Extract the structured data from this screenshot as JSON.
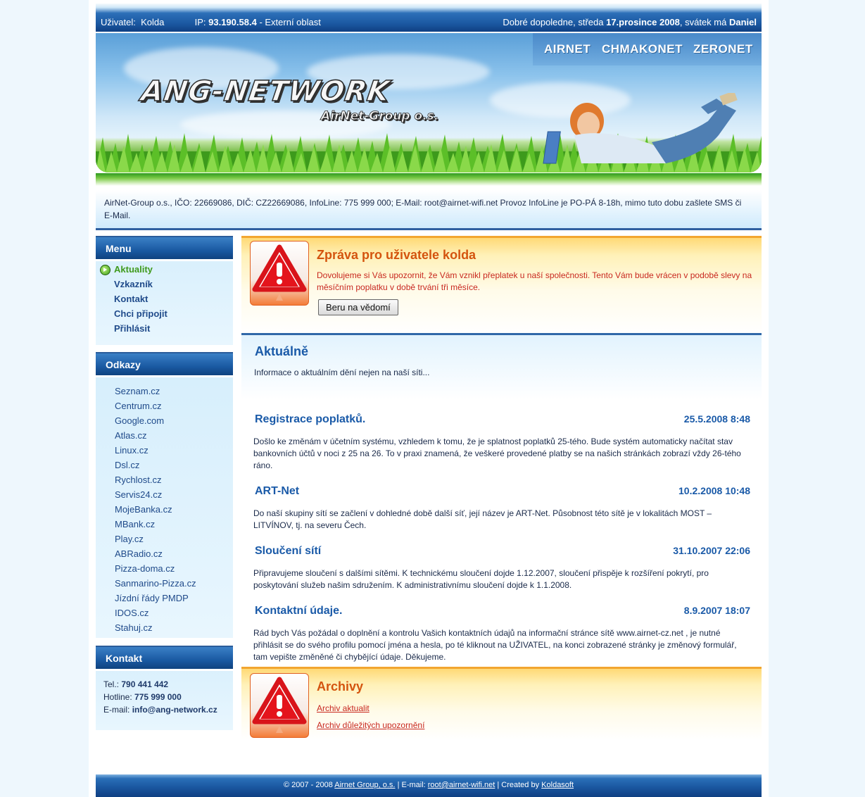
{
  "topbar": {
    "user_label": "Uživatel:",
    "user_name": "Kolda",
    "ip_label": "IP:",
    "ip_value": "93.190.58.4",
    "ip_zone": "- Externí oblast",
    "greeting": "Dobré dopoledne, středa",
    "date": "17.prosince 2008",
    "nameday_label": ", svátek má",
    "nameday_name": "Daniel"
  },
  "header": {
    "logo": "ANG-NETWORK",
    "sublogo": "AirNet-Group o.s.",
    "nav": [
      "AIRNET",
      "CHMAKONET",
      "ZERONET"
    ]
  },
  "info_strip": "AirNet-Group o.s., IČO: 22669086, DIČ: CZ22669086, InfoLine: 775 999 000; E-Mail: root@airnet-wifi.net Provoz InfoLine je PO-PÁ 8-18h, mimo tuto dobu zašlete SMS či E-Mail.",
  "sidebar": {
    "menu_title": "Menu",
    "menu_items": [
      "Aktuality",
      "Vzkazník",
      "Kontakt",
      "Chci připojit",
      "Přihlásit"
    ],
    "links_title": "Odkazy",
    "links": [
      "Seznam.cz",
      "Centrum.cz",
      "Google.com",
      "Atlas.cz",
      "Linux.cz",
      "Dsl.cz",
      "Rychlost.cz",
      "Servis24.cz",
      "MojeBanka.cz",
      "MBank.cz",
      "Play.cz",
      "ABRadio.cz",
      "Pizza-doma.cz",
      "Sanmarino-Pizza.cz",
      "Jízdní řády PMDP",
      "IDOS.cz",
      "Stahuj.cz"
    ],
    "contact_title": "Kontakt",
    "tel_label": "Tel.:",
    "tel": "790 441 442",
    "hotline_label": "Hotline:",
    "hotline": "775 999 000",
    "email_label": "E-mail:",
    "email": "info@ang-network.cz"
  },
  "notice": {
    "title": "Zpráva pro uživatele kolda",
    "text": "Dovolujeme si Vás upozornit, že Vám vznikl přeplatek u naší společnosti. Tento Vám bude vrácen v podobě slevy na měsíčním poplatku v době trvání tři měsíce.",
    "button": "Beru na vědomí"
  },
  "aktualne": {
    "title": "Aktuálně",
    "subtitle": "Informace o aktuálním dění nejen na naší síti..."
  },
  "news": [
    {
      "title": "Registrace poplatků.",
      "date": "25.5.2008 8:48",
      "text": "Došlo ke změnám v účetním systému, vzhledem k tomu, že je splatnost poplatků 25-tého. Bude systém automaticky načítat stav bankovních účtů v noci z 25 na 26. To v praxi znamená, že veškeré provedené platby se na našich stránkách zobrazí vždy 26-tého ráno."
    },
    {
      "title": "ART-Net",
      "date": "10.2.2008 10:48",
      "text": "Do naší skupiny sítí se začlení v dohledné době další síť, její název je ART-Net. Působnost této sítě je v lokalitách MOST – LITVÍNOV, tj. na severu Čech."
    },
    {
      "title": "Sloučení sítí",
      "date": "31.10.2007 22:06",
      "text": "Připravujeme sloučení s dalšími sítěmi. K technickému sloučení dojde 1.12.2007, sloučení přispěje k rozšíření pokrytí, pro poskytování služeb našim sdružením. K administrativnímu sloučení dojde k 1.1.2008."
    },
    {
      "title": "Kontaktní údaje.",
      "date": "8.9.2007 18:07",
      "text": "Rád bych Vás požádal o doplnění a kontrolu Vašich kontaktních údajů na informační stránce sítě www.airnet-cz.net , je nutné přihlásit se do svého profilu pomocí jména a hesla, po té kliknout na UŽIVATEL, na konci zobrazené stránky je změnový formulář, tam vepište změněné či chybějící údaje. Děkujeme."
    }
  ],
  "archiv": {
    "title": "Archivy",
    "link1": "Archiv aktualit",
    "link2": "Archiv důležitých upozornění"
  },
  "footer": {
    "copyright": "© 2007 - 2008",
    "company": "Airnet Group, o.s.",
    "email_label": "| E-mail:",
    "email": "root@airnet-wifi.net",
    "created_label": "| Created by",
    "creator": "Koldasoft"
  },
  "colors": {
    "brand_blue": "#1b58a1",
    "link_blue": "#1a5aa8",
    "warning_orange": "#d4540e",
    "warning_text": "#c8281e",
    "active_green": "#3f9a1c"
  }
}
